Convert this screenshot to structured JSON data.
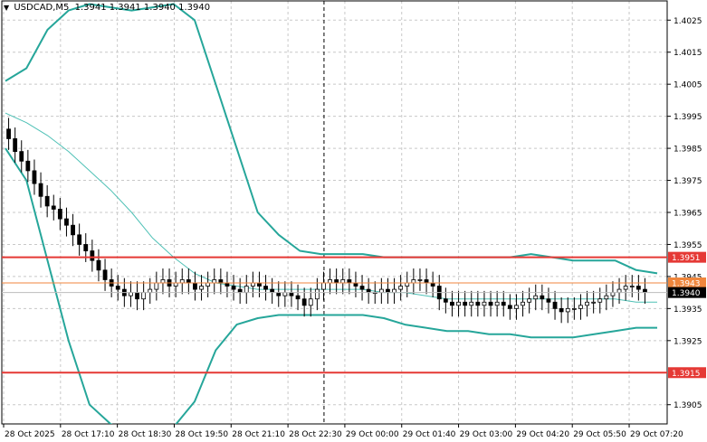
{
  "window": {
    "symbol": "USDCAD,M5",
    "ohlc": "1.3941 1.3941 1.3940 1.3940"
  },
  "colors": {
    "background": "#ffffff",
    "grid": "#c8c8c8",
    "candle_bull": "#ffffff",
    "candle_bear": "#000000",
    "bands": "#26a69a",
    "ma": "#4fc1b6",
    "level_red": "#e53935",
    "level_orange": "#f0863c",
    "bid_line": "#bdbdbd"
  },
  "chart_data": {
    "type": "candlestick",
    "symbol": "USDCAD",
    "timeframe": "M5",
    "ylim": [
      1.3899,
      1.4031
    ],
    "y_ticks": [
      "1.4025",
      "1.4015",
      "1.4005",
      "1.3995",
      "1.3985",
      "1.3975",
      "1.3965",
      "1.3955",
      "1.3945",
      "1.3935",
      "1.3925",
      "1.3905"
    ],
    "x_ticks": [
      "28 Oct 2025",
      "28 Oct 17:10",
      "28 Oct 18:30",
      "28 Oct 19:50",
      "28 Oct 21:10",
      "28 Oct 22:30",
      "29 Oct 00:00",
      "29 Oct 01:40",
      "29 Oct 03:00",
      "29 Oct 04:20",
      "29 Oct 05:50",
      "29 Oct 07:20"
    ],
    "horizontal_levels": [
      {
        "price": 1.3951,
        "label": "1.3951",
        "color": "#e53935"
      },
      {
        "price": 1.3915,
        "label": "1.3915",
        "color": "#e53935"
      },
      {
        "price": 1.3943,
        "label": "1.3943",
        "color": "#f0863c"
      }
    ],
    "current_price": {
      "price": 1.394,
      "label": "1.3940"
    },
    "candle_closes": [
      1.3988,
      1.3984,
      1.3981,
      1.3978,
      1.3974,
      1.397,
      1.3967,
      1.3966,
      1.3963,
      1.3961,
      1.3958,
      1.3955,
      1.3953,
      1.395,
      1.3947,
      1.3944,
      1.3942,
      1.3941,
      1.3939,
      1.394,
      1.3938,
      1.394,
      1.3941,
      1.3943,
      1.3944,
      1.3942,
      1.3943,
      1.3944,
      1.3943,
      1.3941,
      1.3942,
      1.3943,
      1.3944,
      1.3943,
      1.3942,
      1.3941,
      1.394,
      1.3942,
      1.3943,
      1.3942,
      1.3941,
      1.394,
      1.3939,
      1.394,
      1.3939,
      1.3938,
      1.3936,
      1.3938,
      1.3941,
      1.3943,
      1.3944,
      1.3943,
      1.3944,
      1.3943,
      1.3942,
      1.3941,
      1.394,
      1.394,
      1.3941,
      1.394,
      1.3941,
      1.3942,
      1.3943,
      1.3944,
      1.3944,
      1.3943,
      1.3942,
      1.3938,
      1.3937,
      1.3936,
      1.3937,
      1.3936,
      1.3937,
      1.3936,
      1.3937,
      1.3936,
      1.3937,
      1.3936,
      1.3935,
      1.3936,
      1.3937,
      1.3938,
      1.3939,
      1.3938,
      1.3937,
      1.3935,
      1.3934,
      1.3935,
      1.3935,
      1.3936,
      1.3937,
      1.3937,
      1.3938,
      1.3939,
      1.394,
      1.3941,
      1.3942,
      1.3942,
      1.3941,
      1.394
    ],
    "indicators": [
      {
        "name": "Bollinger upper",
        "values": [
          1.4006,
          1.401,
          1.4022,
          1.4028,
          1.403,
          1.4029,
          1.4028,
          1.4029,
          1.403,
          1.4025,
          1.4005,
          1.3985,
          1.3965,
          1.3958,
          1.3953,
          1.3952,
          1.3952,
          1.3952,
          1.3951,
          1.3951,
          1.3951,
          1.3951,
          1.3951,
          1.3951,
          1.3951,
          1.3952,
          1.3951,
          1.395,
          1.395,
          1.395,
          1.3947,
          1.3946
        ]
      },
      {
        "name": "Moving average",
        "values": [
          1.3996,
          1.3993,
          1.3989,
          1.3984,
          1.3978,
          1.3972,
          1.3965,
          1.3957,
          1.3951,
          1.3946,
          1.3943,
          1.3942,
          1.3941,
          1.3941,
          1.3941,
          1.3941,
          1.3941,
          1.3941,
          1.394,
          1.394,
          1.3939,
          1.3938,
          1.3938,
          1.3938,
          1.3938,
          1.3938,
          1.3938,
          1.3938,
          1.3938,
          1.3938,
          1.3937,
          1.3937
        ]
      },
      {
        "name": "Bollinger lower",
        "values": [
          1.3985,
          1.3975,
          1.395,
          1.3925,
          1.3905,
          1.3899,
          1.3896,
          1.3896,
          1.3898,
          1.3906,
          1.3922,
          1.393,
          1.3932,
          1.3933,
          1.3933,
          1.3933,
          1.3933,
          1.3933,
          1.3932,
          1.393,
          1.3929,
          1.3928,
          1.3928,
          1.3927,
          1.3927,
          1.3926,
          1.3926,
          1.3926,
          1.3927,
          1.3928,
          1.3929,
          1.3929
        ]
      }
    ],
    "vertical_marker": {
      "at_tick": "29 Oct 00:00",
      "style": "dashed"
    },
    "grid": true
  }
}
